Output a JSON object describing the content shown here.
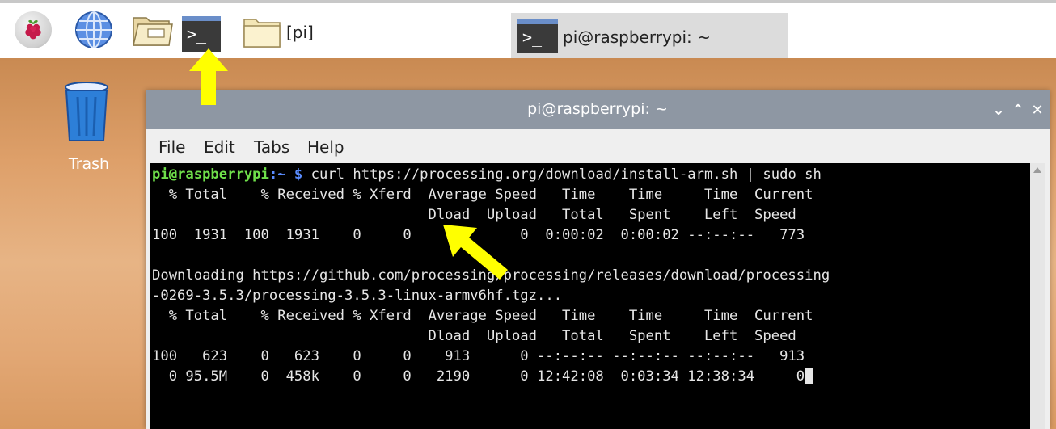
{
  "taskbar": {
    "file_manager_task": {
      "label": "[pi]"
    },
    "terminal_task": {
      "prompt_glyph": ">_",
      "label": "pi@raspberrypi: ~"
    },
    "terminal_launcher": {
      "prompt_glyph": ">_"
    }
  },
  "desktop": {
    "trash": {
      "label": "Trash"
    }
  },
  "window": {
    "title": "pi@raspberrypi: ~",
    "controls": {
      "minimize": "⌄",
      "maximize": "⌃",
      "close": "✕"
    },
    "menu": [
      "File",
      "Edit",
      "Tabs",
      "Help"
    ]
  },
  "terminal": {
    "prompt_user": "pi@raspberrypi",
    "prompt_path": ":~",
    "prompt_symbol": " $",
    "command": " curl https://processing.org/download/install-arm.sh | sudo sh",
    "lines": [
      "  % Total    % Received % Xferd  Average Speed   Time    Time     Time  Current",
      "                                 Dload  Upload   Total   Spent    Left  Speed",
      "100  1931  100  1931    0     0    773      0  0:00:02  0:00:02 --:--:--   773",
      "",
      "Downloading https://github.com/processing/processing/releases/download/processing",
      "-0269-3.5.3/processing-3.5.3-linux-armv6hf.tgz...",
      "  % Total    % Received % Xferd  Average Speed   Time    Time     Time  Current",
      "                                 Dload  Upload   Total   Spent    Left  Speed",
      "100   623    0   623    0     0    913      0 --:--:-- --:--:-- --:--:--   913",
      "  0 95.5M    0  458k    0     0   2190      0 12:42:08  0:03:34 12:38:34     0"
    ]
  },
  "colors": {
    "highlight_arrow": "#ffff00",
    "prompt_user": "#6fe04a",
    "prompt_path": "#5a8cff",
    "titlebar": "#8e97a3"
  }
}
